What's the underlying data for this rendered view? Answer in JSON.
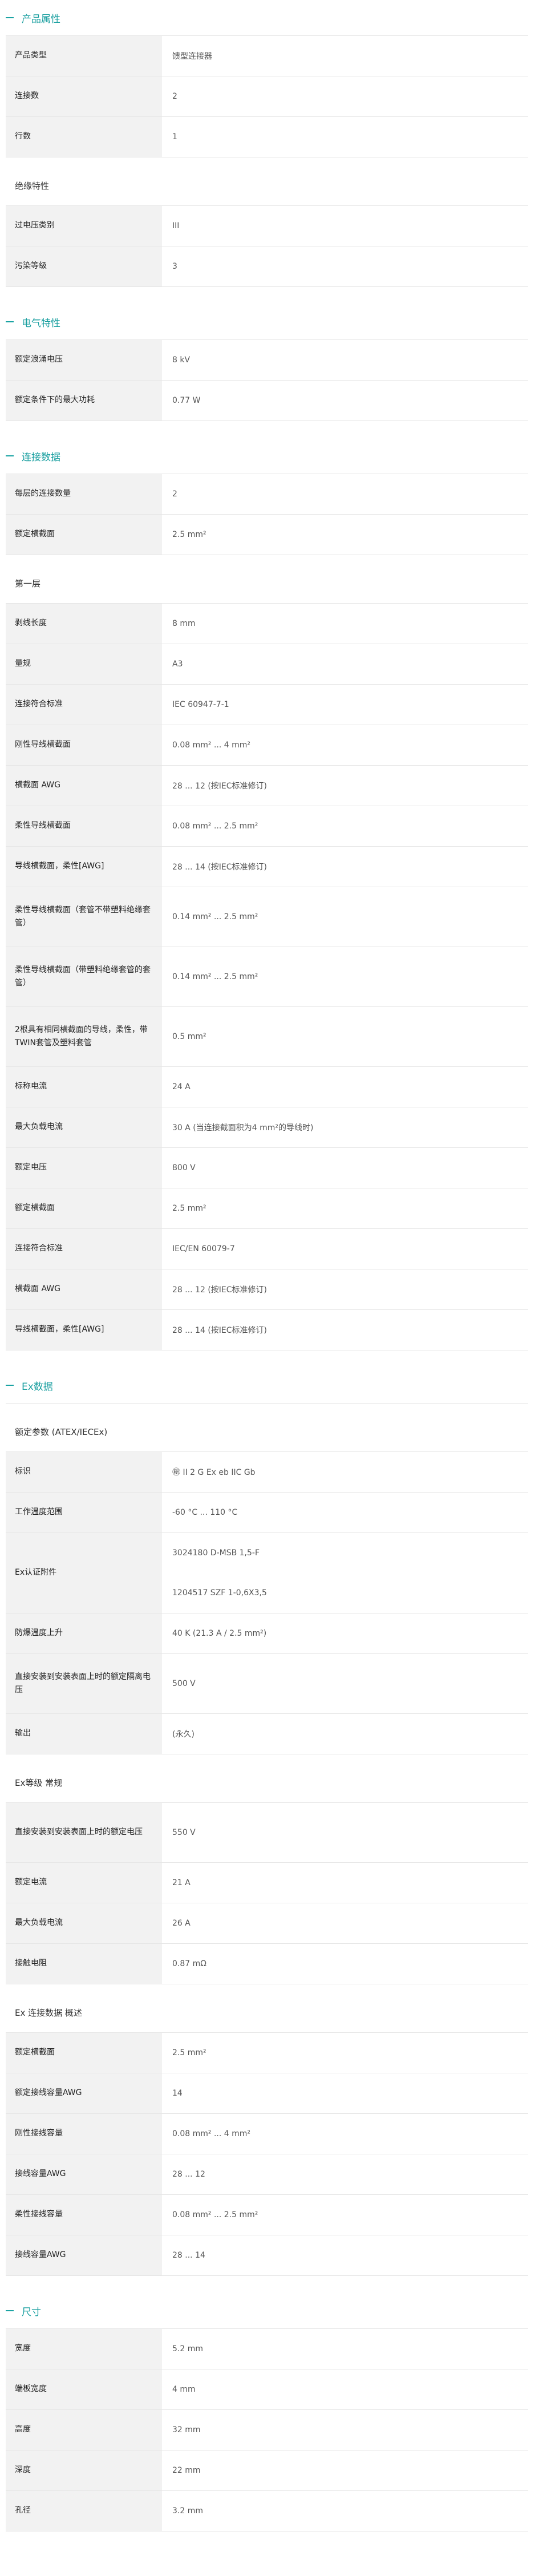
{
  "sections": [
    {
      "title": "产品属性",
      "blocks": [
        {
          "rows": [
            {
              "label": "产品类型",
              "value": "馈型连接器"
            },
            {
              "label": "连接数",
              "value": "2"
            },
            {
              "label": "行数",
              "value": "1"
            }
          ]
        },
        {
          "subhead": "绝缘特性",
          "rows": [
            {
              "label": "过电压类别",
              "value": "III"
            },
            {
              "label": "污染等级",
              "value": "3"
            }
          ]
        }
      ]
    },
    {
      "title": "电气特性",
      "blocks": [
        {
          "rows": [
            {
              "label": "额定浪涌电压",
              "value": "8 kV"
            },
            {
              "label": "额定条件下的最大功耗",
              "value": "0.77 W"
            }
          ]
        }
      ]
    },
    {
      "title": "连接数据",
      "blocks": [
        {
          "rows": [
            {
              "label": "每层的连接数量",
              "value": "2"
            },
            {
              "label": "额定横截面",
              "value": "2.5 mm²"
            }
          ]
        },
        {
          "subhead": "第一层",
          "rows": [
            {
              "label": "剥线长度",
              "value": "8 mm"
            },
            {
              "label": "量规",
              "value": "A3"
            },
            {
              "label": "连接符合标准",
              "value": "IEC 60947-7-1"
            },
            {
              "label": "刚性导线横截面",
              "value": "0.08 mm² ... 4 mm²"
            },
            {
              "label": "横截面 AWG",
              "value": "28 ... 12 (按IEC标准修订)"
            },
            {
              "label": "柔性导线横截面",
              "value": "0.08 mm² ... 2.5 mm²"
            },
            {
              "label": "导线横截面，柔性[AWG]",
              "value": "28 ... 14 (按IEC标准修订)"
            },
            {
              "label": "柔性导线横截面（套管不带塑料绝缘套管）",
              "value": "0.14 mm² ... 2.5 mm²",
              "tall": true
            },
            {
              "label": "柔性导线横截面（带塑料绝缘套管的套管）",
              "value": "0.14 mm² ... 2.5 mm²",
              "tall": true
            },
            {
              "label": "2根具有相同横截面的导线，柔性，带TWIN套管及塑料套管",
              "value": "0.5 mm²",
              "tall": true
            },
            {
              "label": "标称电流",
              "value": "24 A"
            },
            {
              "label": "最大负载电流",
              "value": "30 A (当连接截面积为4 mm²的导线时)"
            },
            {
              "label": "额定电压",
              "value": "800 V"
            },
            {
              "label": "额定横截面",
              "value": "2.5 mm²"
            },
            {
              "label": "连接符合标准",
              "value": "IEC/EN 60079-7"
            },
            {
              "label": "横截面 AWG",
              "value": "28 ... 12 (按IEC标准修订)"
            },
            {
              "label": "导线横截面，柔性[AWG]",
              "value": "28 ... 14 (按IEC标准修订)"
            }
          ]
        }
      ]
    },
    {
      "title": "Ex数据",
      "blocks": [
        {
          "subhead": "额定参数 (ATEX/IECEx)",
          "rows": [
            {
              "label": "标识",
              "value": "㊙ II 2 G  Ex eb IIC Gb"
            },
            {
              "label": "工作温度范围",
              "value": "-60 °C ... 110 °C"
            },
            {
              "label": "Ex认证附件",
              "values": [
                "3024180 D-MSB 1,5-F",
                "1204517 SZF 1-0,6X3,5"
              ]
            },
            {
              "label": "防爆温度上升",
              "value": "40 K (21.3 A / 2.5 mm²)"
            },
            {
              "label": "直接安装到安装表面上时的额定隔离电压",
              "value": "500 V",
              "tall": true
            },
            {
              "label": "输出",
              "value": "(永久)"
            }
          ]
        },
        {
          "subhead": "Ex等级 常规",
          "rows": [
            {
              "label": "直接安装到安装表面上时的额定电压",
              "value": "550 V",
              "tall": true
            },
            {
              "label": "额定电流",
              "value": "21 A"
            },
            {
              "label": "最大负载电流",
              "value": "26 A"
            },
            {
              "label": "接触电阻",
              "value": "0.87 mΩ"
            }
          ]
        },
        {
          "subhead": "Ex 连接数据 概述",
          "rows": [
            {
              "label": "额定横截面",
              "value": "2.5 mm²"
            },
            {
              "label": "额定接线容量AWG",
              "value": "14"
            },
            {
              "label": "刚性接线容量",
              "value": "0.08 mm² ... 4 mm²"
            },
            {
              "label": "接线容量AWG",
              "value": "28 ... 12"
            },
            {
              "label": "柔性接线容量",
              "value": "0.08 mm² ... 2.5 mm²"
            },
            {
              "label": "接线容量AWG",
              "value": "28 ... 14"
            }
          ]
        }
      ]
    },
    {
      "title": "尺寸",
      "blocks": [
        {
          "rows": [
            {
              "label": "宽度",
              "value": "5.2 mm"
            },
            {
              "label": "端板宽度",
              "value": "4 mm"
            },
            {
              "label": "高度",
              "value": "32 mm"
            },
            {
              "label": "深度",
              "value": "22 mm"
            },
            {
              "label": "孔径",
              "value": "3.2 mm"
            }
          ]
        }
      ]
    }
  ],
  "colors": {
    "accent": "#1a9fa0",
    "label_bg": "#f2f2f2",
    "divider": "#e6e6e6"
  }
}
